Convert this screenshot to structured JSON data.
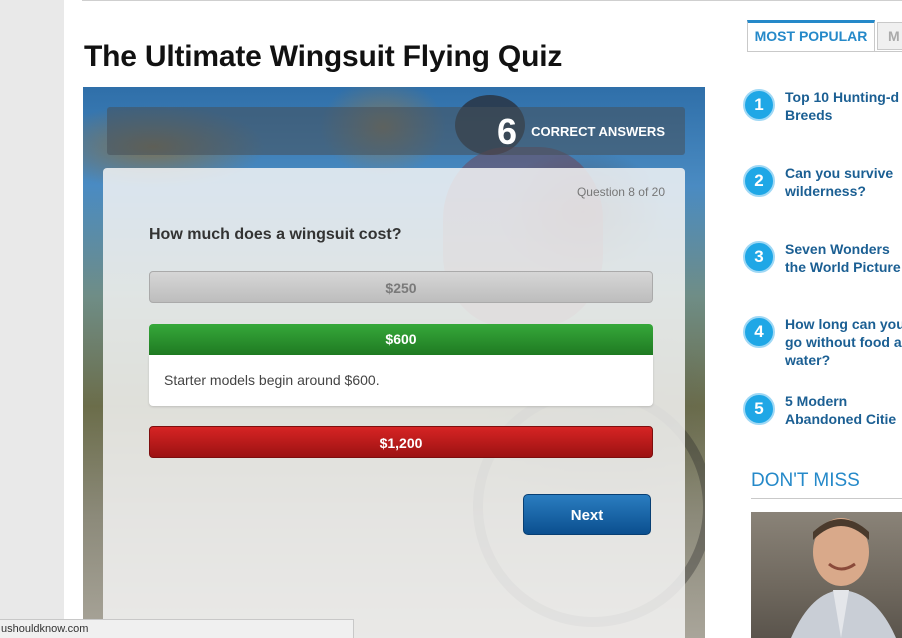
{
  "quiz": {
    "title": "The Ultimate Wingsuit Flying Quiz",
    "score_number": "6",
    "score_label": "CORRECT ANSWERS",
    "question_counter": "Question 8 of 20",
    "question": "How much does a wingsuit cost?",
    "answers": [
      {
        "label": "$250",
        "state": "disabled"
      },
      {
        "label": "$600",
        "state": "correct"
      },
      {
        "label": "$1,200",
        "state": "wrong"
      }
    ],
    "explanation": "Starter models begin around $600.",
    "next_label": "Next"
  },
  "sidebar": {
    "tabs": [
      "MOST POPULAR",
      "M"
    ],
    "popular": [
      {
        "rank": "1",
        "text": "Top 10 Hunting-d\nBreeds"
      },
      {
        "rank": "2",
        "text": "Can you survive\nwilderness?"
      },
      {
        "rank": "3",
        "text": "Seven Wonders\nthe World Picture"
      },
      {
        "rank": "4",
        "text": "How long can you\ngo without food a\nwater?"
      },
      {
        "rank": "5",
        "text": "5 Modern\nAbandoned Citie"
      }
    ],
    "dont_miss_title": "DON'T MISS"
  },
  "status_bar": {
    "url": "ushouldknow.com"
  },
  "colors": {
    "accent_blue": "#2589c9",
    "correct_green": "#2a9a2e",
    "wrong_red": "#bb1c1c",
    "link_blue": "#1b5f93"
  }
}
